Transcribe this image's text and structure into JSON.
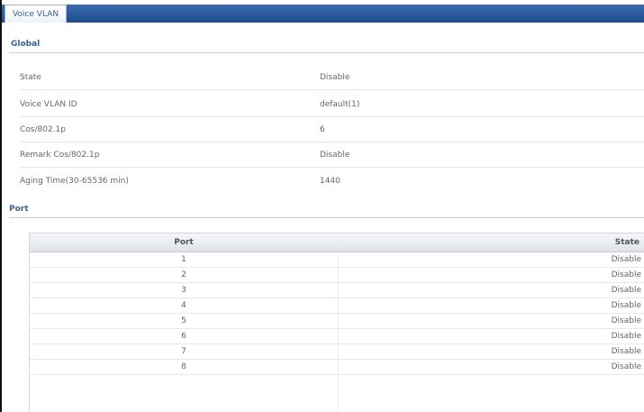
{
  "tab": {
    "label": "Voice VLAN"
  },
  "global": {
    "title": "Global",
    "fields": [
      {
        "label": "State",
        "value": "Disable"
      },
      {
        "label": "Voice VLAN ID",
        "value": "default(1)"
      },
      {
        "label": "Cos/802.1p",
        "value": "6"
      },
      {
        "label": "Remark Cos/802.1p",
        "value": "Disable"
      },
      {
        "label": "Aging Time(30-65536 min)",
        "value": "1440"
      }
    ]
  },
  "port": {
    "title": "Port",
    "columns": {
      "port": "Port",
      "state": "State"
    },
    "rows": [
      {
        "port": "1",
        "state": "Disable"
      },
      {
        "port": "2",
        "state": "Disable"
      },
      {
        "port": "3",
        "state": "Disable"
      },
      {
        "port": "4",
        "state": "Disable"
      },
      {
        "port": "5",
        "state": "Disable"
      },
      {
        "port": "6",
        "state": "Disable"
      },
      {
        "port": "7",
        "state": "Disable"
      },
      {
        "port": "8",
        "state": "Disable"
      }
    ]
  }
}
